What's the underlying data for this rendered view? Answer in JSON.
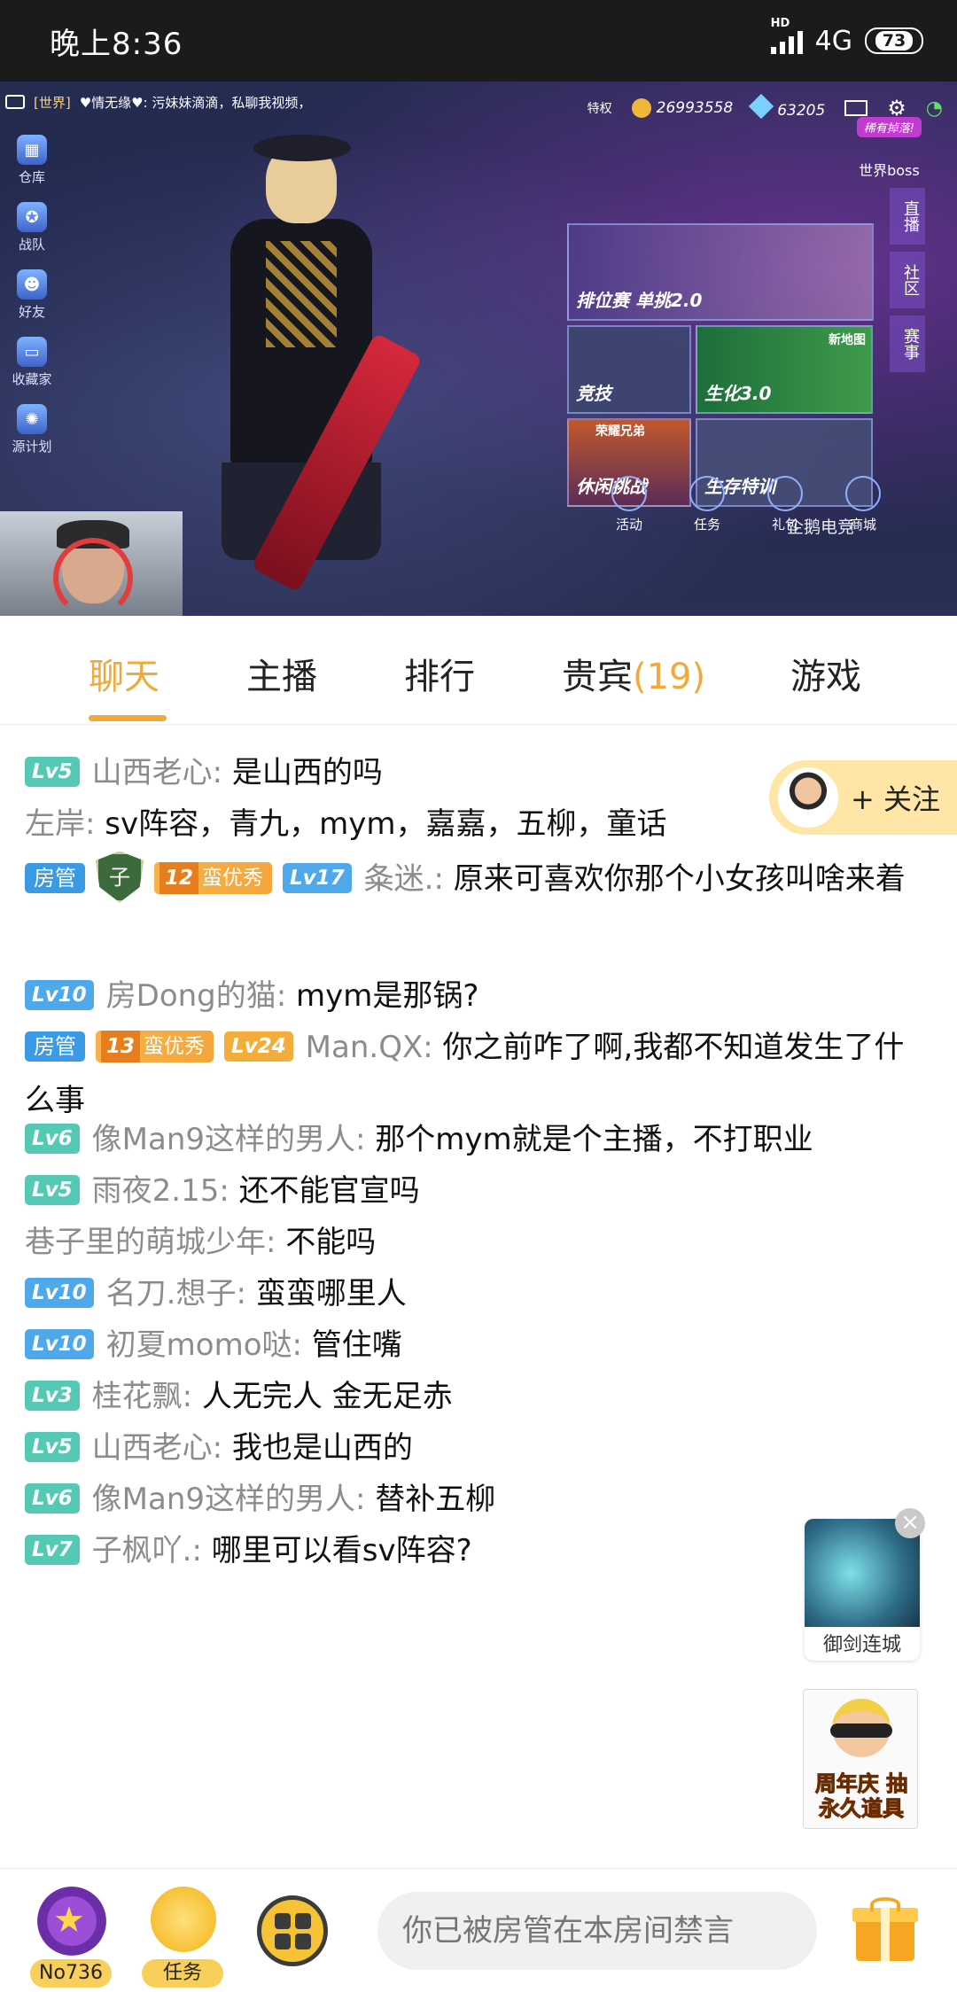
{
  "status_bar": {
    "time": "晚上8:36",
    "network": "4G",
    "hd": "HD",
    "battery": "73"
  },
  "video": {
    "ticker_channel": "[世界]",
    "ticker_text": "♥情无缘♥: 污妹妹滴滴，私聊我视频，",
    "privilege": "特权",
    "coins": "26993558",
    "diamonds": "63205",
    "left_menu": [
      "仓库",
      "战队",
      "好友",
      "收藏家",
      "源计划"
    ],
    "world_boss_badge": "稀有掉落!",
    "world_boss_label": "世界boss",
    "modes": [
      "排位赛 单挑2.0",
      "竞技",
      "生化3.0",
      "休闲挑战",
      "生存特训"
    ],
    "mode_tags": [
      "新地图",
      "荣耀兄弟"
    ],
    "side_tabs": [
      "直播",
      "社区",
      "赛事"
    ],
    "bottom_icons": [
      "活动",
      "任务",
      "礼包",
      "商城"
    ],
    "bottom_overlay": "企鹅电竞"
  },
  "tabs": [
    {
      "label": "聊天",
      "active": true
    },
    {
      "label": "主播"
    },
    {
      "label": "排行"
    },
    {
      "label": "贵宾",
      "count": "(19)"
    },
    {
      "label": "游戏"
    }
  ],
  "follow": {
    "label": "+ 关注"
  },
  "messages": [
    {
      "level": "Lv5",
      "user": "山西老心",
      "text": "是山西的吗"
    },
    {
      "user": "左岸",
      "text": "sv阵容，青九，mym，嘉嘉，五柳，童话"
    },
    {
      "badge": "房管",
      "shield": "子",
      "vip_num": "12",
      "vip_label": "蛮优秀",
      "level": "Lv17",
      "user": "夈迷.",
      "text": "原来可喜欢你那个小女孩叫啥来着"
    },
    {
      "level": "Lv10",
      "user": "房Dong的猫",
      "text": "mym是那锅?"
    },
    {
      "badge": "房管",
      "vip_num": "13",
      "vip_label": "蛮优秀",
      "level": "Lv24",
      "user": "Man.QX",
      "text": "你之前咋了啊,我都不知道发生了什么事"
    },
    {
      "level": "Lv6",
      "user": "像Man9这样的男人",
      "text": "那个mym就是个主播，不打职业"
    },
    {
      "level": "Lv5",
      "user": "雨夜2.15",
      "text": "还不能官宣吗"
    },
    {
      "user": "巷子里的萌城少年",
      "text": "不能吗"
    },
    {
      "level": "Lv10",
      "user": "名刀.想子",
      "text": "蛮蛮哪里人"
    },
    {
      "level": "Lv10",
      "user": "初夏momo哒",
      "text": "管住嘴"
    },
    {
      "level": "Lv3",
      "user": "桂花飘",
      "text": "人无完人 金无足赤"
    },
    {
      "level": "Lv5",
      "user": "山西老心",
      "text": "我也是山西的"
    },
    {
      "level": "Lv6",
      "user": "像Man9这样的男人",
      "text": "替补五柳"
    },
    {
      "level": "Lv7",
      "user": "子枫吖.",
      "text": "哪里可以看sv阵容?"
    }
  ],
  "ads": {
    "ad1_label": "御剑连城",
    "ad2_text": "周年庆 抽永久道具"
  },
  "bottom_bar": {
    "rank_label": "No736",
    "task_label": "任务",
    "input_placeholder": "你已被房管在本房间禁言"
  },
  "colors": {
    "accent": "#f2a93b",
    "level_green": "#56c9b4",
    "level_blue": "#4ea8e9",
    "admin_blue": "#3a9ae6"
  }
}
